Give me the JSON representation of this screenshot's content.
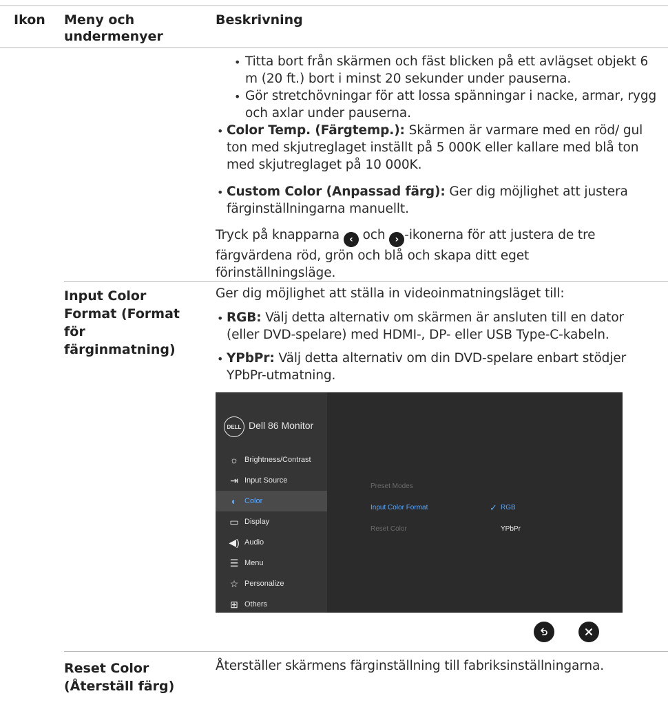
{
  "table": {
    "col_icon": "Ikon",
    "col_menu": "Meny och undermenyer",
    "col_desc": "Beskrivning"
  },
  "color_section": {
    "sub_bullet_1": "Titta bort från skärmen och fäst blicken på ett avlägset objekt 6 m (20 ft.) bort i minst 20 sekunder under pauserna.",
    "sub_bullet_2": "Gör stretchövningar för att lossa spänningar i nacke, armar, rygg och axlar under pauserna.",
    "color_temp_term": "Color Temp. (Färgtemp.):",
    "color_temp_text": " Skärmen är varmare med en röd/ gul ton med skjutreglaget inställt på 5 000K eller kallare med blå ton med skjutreglaget på 10 000K.",
    "custom_color_term": "Custom Color (Anpassad färg):",
    "custom_color_text": " Ger dig möjlighet att justera färginställningarna manuellt.",
    "press_text_a": "Tryck på knapparna ",
    "press_text_b": " och ",
    "press_text_c": "-ikonerna för att justera de tre färgvärdena röd, grön och blå och skapa ditt eget förinställningsläge."
  },
  "input_color_format": {
    "label": "Input Color Format (Format för färginmatning)",
    "intro": "Ger dig möjlighet att ställa in videoinmatningsläget till:",
    "rgb_term": "RGB:",
    "rgb_text": " Välj detta alternativ om skärmen är ansluten till en dator (eller DVD-spelare) med HDMI-, DP- eller USB Type-C-kabeln.",
    "ypbpr_term": "YPbPr:",
    "ypbpr_text": " Välj detta alternativ om din DVD-spelare enbart stödjer YPbPr-utmatning."
  },
  "osd": {
    "logo": "DELL",
    "title": "Dell 86 Monitor",
    "menu_items": [
      {
        "label": "Brightness/Contrast",
        "icon": "brightness-icon"
      },
      {
        "label": "Input Source",
        "icon": "input-source-icon"
      },
      {
        "label": "Color",
        "icon": "palette-icon"
      },
      {
        "label": "Display",
        "icon": "display-icon"
      },
      {
        "label": "Audio",
        "icon": "speaker-icon"
      },
      {
        "label": "Menu",
        "icon": "menu-icon"
      },
      {
        "label": "Personalize",
        "icon": "star-icon"
      },
      {
        "label": "Others",
        "icon": "others-icon"
      }
    ],
    "sub_preset": "Preset Modes",
    "sub_input_color_format": "Input Color Format",
    "sub_reset_color": "Reset Color",
    "option_rgb": "RGB",
    "option_ypbpr": "YPbPr",
    "accent": "#58a8ff"
  },
  "reset_color": {
    "label": "Reset Color (Återställ färg)",
    "text": "Återställer skärmens färginställning till fabriksinställningarna."
  }
}
